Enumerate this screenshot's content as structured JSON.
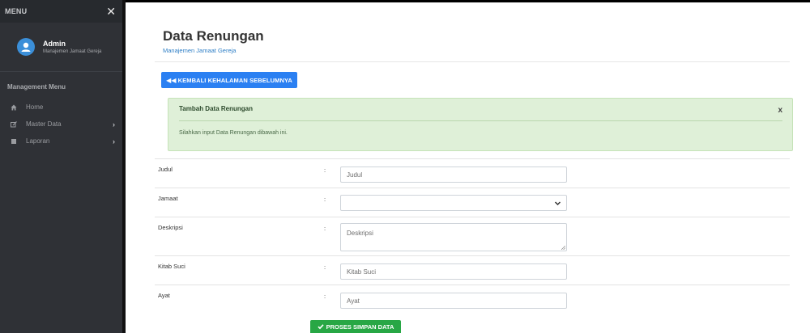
{
  "sidebar": {
    "menu_title": "MENU",
    "close_icon": "close-icon",
    "profile": {
      "name": "Admin",
      "subtitle": "Manajemen Jamaat Gereja",
      "avatar_color": "#3b8fd9"
    },
    "section_label": "Management Menu",
    "items": [
      {
        "label": "Home",
        "icon": "home-icon",
        "has_submenu": false
      },
      {
        "label": "Master Data",
        "icon": "edit-icon",
        "has_submenu": true
      },
      {
        "label": "Laporan",
        "icon": "report-icon",
        "has_submenu": true
      }
    ]
  },
  "header": {
    "title": "Data Renungan",
    "subtitle": "Manajemen Jamaat Gereja"
  },
  "back_button": {
    "label": "KEMBALI KEHALAMAN SEBELUMNYA",
    "icon": "double-chevron-left-icon",
    "color": "#2b80f2"
  },
  "alert": {
    "title": "Tambah Data Renungan",
    "close_label": "x",
    "message": "Silahkan input Data Renungan dibawah ini.",
    "background": "#dff0d8"
  },
  "form": {
    "judul": {
      "label": "Judul",
      "colon": ":",
      "placeholder": "Judul",
      "value": ""
    },
    "jamaat": {
      "label": "Jamaat",
      "colon": ":",
      "selected": ""
    },
    "deskripsi": {
      "label": "Deskripsi",
      "colon": ":",
      "placeholder": "Deskripsi",
      "value": ""
    },
    "kitab_suci": {
      "label": "Kitab Suci",
      "colon": ":",
      "placeholder": "Kitab Suci",
      "value": ""
    },
    "ayat": {
      "label": "Ayat",
      "colon": ":",
      "placeholder": "Ayat",
      "value": ""
    }
  },
  "submit_button": {
    "label": "PROSES SIMPAN DATA",
    "icon": "check-icon",
    "color": "#28a745"
  }
}
